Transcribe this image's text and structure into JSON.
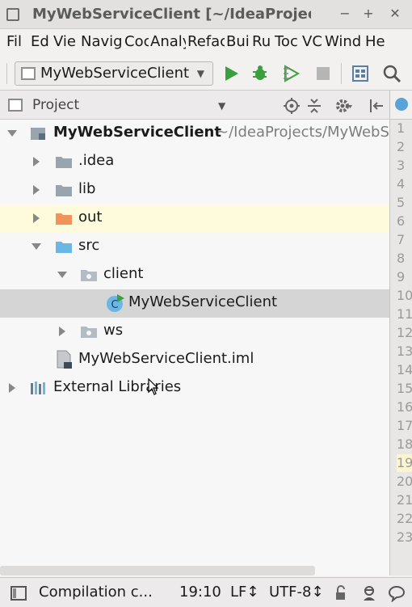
{
  "window": {
    "title": "MyWebServiceClient [~/IdeaProjects/M",
    "buttons": [
      "−",
      "+",
      "✕"
    ]
  },
  "menu": {
    "items": [
      "Fil",
      "Ed",
      "Vie",
      "Navig",
      "Coc",
      "Analy",
      "Refac",
      "Bui",
      "Ru",
      "Toc",
      "VC",
      "Wind",
      "He"
    ]
  },
  "toolbar": {
    "run_config": "MyWebServiceClient"
  },
  "project_panel": {
    "title": "Project"
  },
  "tree": {
    "root": {
      "name": "MyWebServiceClient",
      "path": "~/IdeaProjects/MyWebS"
    },
    "idea": ".idea",
    "lib": "lib",
    "out": "out",
    "src": "src",
    "client": "client",
    "main_class": "MyWebServiceClient",
    "ws": "ws",
    "iml": "MyWebServiceClient.iml",
    "external": "External Libraries"
  },
  "editor": {
    "line_numbers": [
      "1",
      "2",
      "3",
      "4",
      "5",
      "6",
      "7",
      "8",
      "9",
      "10",
      "11",
      "12",
      "13",
      "14",
      "15",
      "16",
      "17",
      "18",
      "19",
      "20",
      "21",
      "22",
      "23"
    ],
    "current_line": "19"
  },
  "status": {
    "message": "Compilation c...",
    "position": "19:10",
    "line_sep": "LF↕",
    "encoding": "UTF-8↕"
  },
  "colors": {
    "run_green": "#3aa03d",
    "folder_grey": "#9aa4ad",
    "folder_orange": "#f0945a",
    "folder_blue": "#6ab7e6",
    "highlight_row": "#fdfbdc",
    "selected_row": "#d5d5d5"
  }
}
